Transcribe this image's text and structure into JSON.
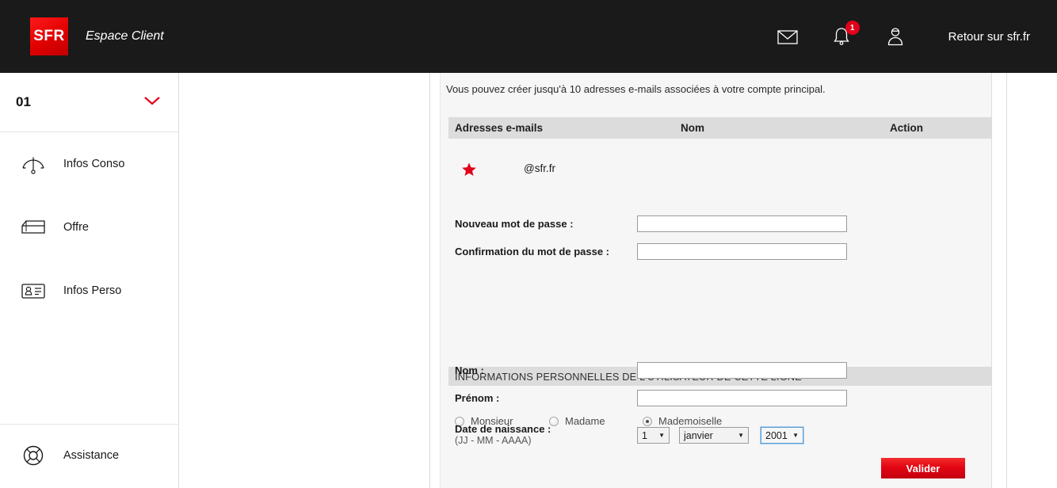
{
  "header": {
    "logo_text": "SFR",
    "app_title": "Espace Client",
    "mail_icon": "envelope-icon",
    "bell_icon": "bell-icon",
    "notification_count": "1",
    "account_icon": "person-icon",
    "back_link": "Retour sur sfr.fr"
  },
  "sidebar": {
    "line_number": "01",
    "chevron_icon": "chevron-down-icon",
    "accent_color": "#e2001a",
    "items": [
      {
        "label": "Infos Conso",
        "icon": "gauge-icon"
      },
      {
        "label": "Offre",
        "icon": "box-icon"
      },
      {
        "label": "Infos Perso",
        "icon": "id-card-icon"
      }
    ],
    "assistance": {
      "label": "Assistance",
      "icon": "life-ring-icon"
    }
  },
  "content": {
    "intro": "Vous pouvez créer jusqu'à 10 adresses e-mails associées à votre compte principal.",
    "table": {
      "columns": [
        "Adresses e-mails",
        "Nom",
        "Action"
      ],
      "rows": [
        {
          "star_icon": "star-icon",
          "email": "@sfr.fr",
          "nom": "",
          "action": ""
        }
      ]
    },
    "password": {
      "new_label": "Nouveau mot de passe :",
      "new_value": "",
      "confirm_label": "Confirmation du mot de passe :",
      "confirm_value": ""
    },
    "section_title": "INFORMATIONS PERSONNELLES DE L'UTILISATEUR DE CETTE LIGNE",
    "civility": {
      "options": [
        "Monsieur",
        "Madame",
        "Mademoiselle"
      ],
      "selected": "Mademoiselle"
    },
    "nom": {
      "label": "Nom :",
      "value": ""
    },
    "prenom": {
      "label": "Prénom :",
      "value": ""
    },
    "birthdate": {
      "label": "Date de naissance :",
      "format_hint": "(JJ - MM - AAAA)",
      "day": "1",
      "month": "janvier",
      "year": "2001",
      "caret_icon": "caret-down-icon"
    },
    "submit_label": "Valider",
    "submit_color": "#e30613"
  }
}
